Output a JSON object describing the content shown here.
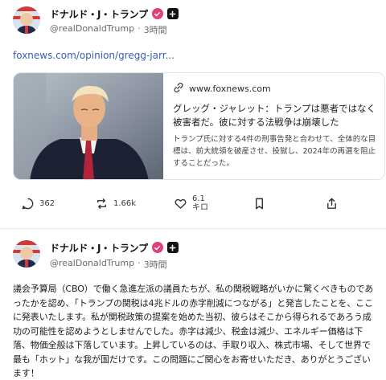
{
  "posts": [
    {
      "display_name": "ドナルド・J・トランプ",
      "handle": "@realDonaldTrump",
      "separator": "·",
      "time": "3時間",
      "link": "foxnews.com/opinion/gregg-jarr...",
      "card": {
        "domain": "www.foxnews.com",
        "title": "グレッグ・ジャレット：トランプは悪者ではなく被害者だ。彼に対する法戦争は崩壊した",
        "description": "トランプ氏に対する4件の刑事告発と合わせて、全体的な目標は、前大統領を破産させ、投獄し、2024年の再選を阻止することだった。"
      },
      "actions": {
        "reply_count": "362",
        "repost_count": "1.66k",
        "like_count": "6.1キロ"
      }
    },
    {
      "display_name": "ドナルド・J・トランプ",
      "handle": "@realDonaldTrump",
      "separator": "·",
      "time": "3時間",
      "body": "議会予算局（CBO）で働く急進左派の議員たちが、私の関税戦略がいかに驚くべきものであったかを認め、「トランプの関税は4兆ドルの赤字削減につながる」と発言したことを、ここに発表いたします。私が関税政策の提案を始めた当初、彼らはそこから得られるであろう成功の可能性を認めようとしませんでした。赤字は減少、税金は減少、エネルギー価格は下落、物価全般は下落しています。上昇しているのは、手取り収入、株式市場、そして世界で最も「ホット」な我が国だけです。この問題にご関心をお寄せいただき、ありがとうございます！"
    }
  ],
  "icons": {
    "verified": "verified-badge-icon",
    "plus": "plus-badge-icon",
    "link": "link-icon",
    "reply": "reply-icon",
    "repost": "repost-icon",
    "like": "heart-icon",
    "bookmark": "bookmark-icon",
    "share": "share-icon"
  },
  "colors": {
    "link": "#3b5bb8",
    "verified": "#e0417d",
    "muted_text": "#666b70"
  }
}
